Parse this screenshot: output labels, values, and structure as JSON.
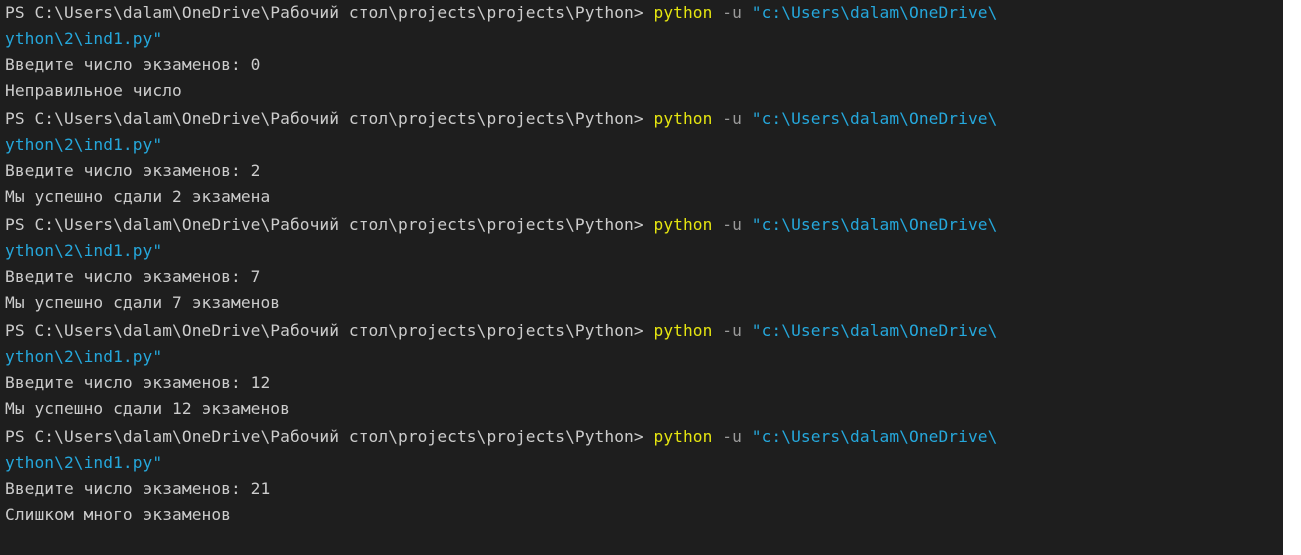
{
  "terminal": {
    "colors": {
      "background": "#1e1e1e",
      "text": "#cccccc",
      "command": "#e5e510",
      "flag": "#9a9a9a",
      "string": "#25a7db"
    },
    "runs": [
      {
        "prompt": "PS C:\\Users\\dalam\\OneDrive\\Рабочий стол\\projects\\projects\\Python> ",
        "command": "python",
        "flag": " -u ",
        "path_start": "\"c:\\Users\\dalam\\OneDrive\\",
        "path_cont": "ython\\2\\ind1.py\"",
        "input": "Введите число экзаменов: 0",
        "output": "Неправильное число"
      },
      {
        "prompt": "PS C:\\Users\\dalam\\OneDrive\\Рабочий стол\\projects\\projects\\Python> ",
        "command": "python",
        "flag": " -u ",
        "path_start": "\"c:\\Users\\dalam\\OneDrive\\",
        "path_cont": "ython\\2\\ind1.py\"",
        "input": "Введите число экзаменов: 2",
        "output": "Мы успешно сдали 2 экзамена"
      },
      {
        "prompt": "PS C:\\Users\\dalam\\OneDrive\\Рабочий стол\\projects\\projects\\Python> ",
        "command": "python",
        "flag": " -u ",
        "path_start": "\"c:\\Users\\dalam\\OneDrive\\",
        "path_cont": "ython\\2\\ind1.py\"",
        "input": "Введите число экзаменов: 7",
        "output": "Мы успешно сдали 7 экзаменов"
      },
      {
        "prompt": "PS C:\\Users\\dalam\\OneDrive\\Рабочий стол\\projects\\projects\\Python> ",
        "command": "python",
        "flag": " -u ",
        "path_start": "\"c:\\Users\\dalam\\OneDrive\\",
        "path_cont": "ython\\2\\ind1.py\"",
        "input": "Введите число экзаменов: 12",
        "output": "Мы успешно сдали 12 экзаменов"
      },
      {
        "prompt": "PS C:\\Users\\dalam\\OneDrive\\Рабочий стол\\projects\\projects\\Python> ",
        "command": "python",
        "flag": " -u ",
        "path_start": "\"c:\\Users\\dalam\\OneDrive\\",
        "path_cont": "ython\\2\\ind1.py\"",
        "input": "Введите число экзаменов: 21",
        "output": "Слишком много экзаменов"
      }
    ]
  }
}
